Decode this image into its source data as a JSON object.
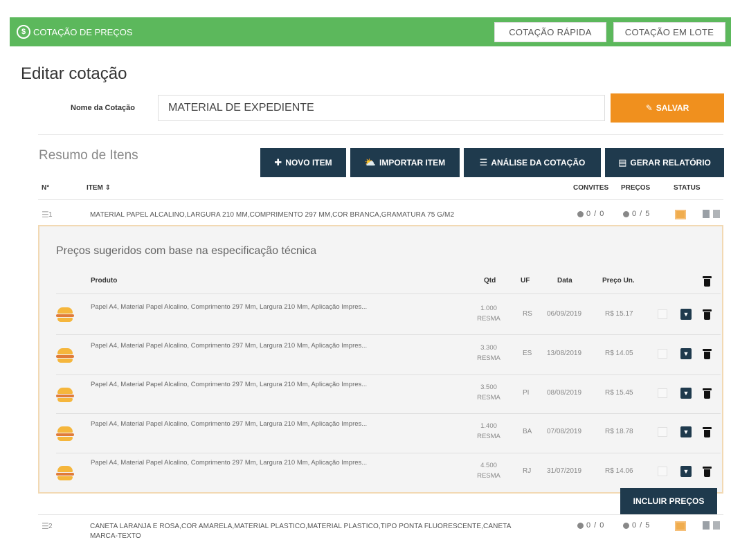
{
  "topbar": {
    "brand_label": "COTAÇÃO DE PREÇOS",
    "quick_quote": "COTAÇÃO RÁPIDA",
    "batch_quote": "COTAÇÃO EM LOTE"
  },
  "page": {
    "title": "Editar cotação",
    "name_label": "Nome da Cotação",
    "name_value": "MATERIAL DE EXPEDIENTE",
    "save_label": "SALVAR"
  },
  "summary": {
    "title": "Resumo de Itens",
    "new_item": "NOVO ITEM",
    "import_item": "IMPORTAR ITEM",
    "analysis": "ANÁLISE DA COTAÇÃO",
    "report": "GERAR RELATÓRIO"
  },
  "table": {
    "headers": {
      "num": "N°",
      "item": "ITEM ⇕",
      "invites": "CONVITES",
      "prices": "PREÇOS",
      "status": "STATUS"
    },
    "rows": [
      {
        "num": "1",
        "description": "MATERIAL PAPEL ALCALINO,LARGURA 210 MM,COMPRIMENTO 297 MM,COR BRANCA,GRAMATURA 75 G/M2",
        "invites": "0 / 0",
        "prices": "0 / 5"
      },
      {
        "num": "2",
        "description_line1": "CANETA LARANJA E ROSA,COR AMARELA,MATERIAL PLASTICO,MATERIAL PLASTICO,TIPO PONTA FLUORESCENTE,CANETA",
        "description_line2": "MARCA-TEXTO",
        "invites": "0 / 0",
        "prices": "0 / 5"
      }
    ]
  },
  "suggested": {
    "title": "Preços sugeridos com base na especificação técnica",
    "headers": {
      "product": "Produto",
      "qty": "Qtd",
      "uf": "UF",
      "date": "Data",
      "price": "Preço Un."
    },
    "items": [
      {
        "product": "Papel A4, Material Papel Alcalino, Comprimento 297 Mm, Largura 210 Mm, Aplicação Impres...",
        "qty": "1.000",
        "unit": "RESMA",
        "uf": "RS",
        "date": "06/09/2019",
        "price": "R$ 15.17"
      },
      {
        "product": "Papel A4, Material Papel Alcalino, Comprimento 297 Mm, Largura 210 Mm, Aplicação Impres...",
        "qty": "3.300",
        "unit": "RESMA",
        "uf": "ES",
        "date": "13/08/2019",
        "price": "R$ 14.05"
      },
      {
        "product": "Papel A4, Material Papel Alcalino, Comprimento 297 Mm, Largura 210 Mm, Aplicação Impres...",
        "qty": "3.500",
        "unit": "RESMA",
        "uf": "PI",
        "date": "08/08/2019",
        "price": "R$ 15.45"
      },
      {
        "product": "Papel A4, Material Papel Alcalino, Comprimento 297 Mm, Largura 210 Mm, Aplicação Impres...",
        "qty": "1.400",
        "unit": "RESMA",
        "uf": "BA",
        "date": "07/08/2019",
        "price": "R$ 18.78"
      },
      {
        "product": "Papel A4, Material Papel Alcalino, Comprimento 297 Mm, Largura 210 Mm, Aplicação Impres...",
        "qty": "4.500",
        "unit": "RESMA",
        "uf": "RJ",
        "date": "31/07/2019",
        "price": "R$ 14.06"
      }
    ],
    "include_label": "INCLUIR PREÇOS"
  },
  "colors": {
    "topbar": "#5cb85c",
    "primary_dark": "#1f3a4d",
    "accent_orange": "#f0901e",
    "status_orange": "#f0ad4e"
  }
}
